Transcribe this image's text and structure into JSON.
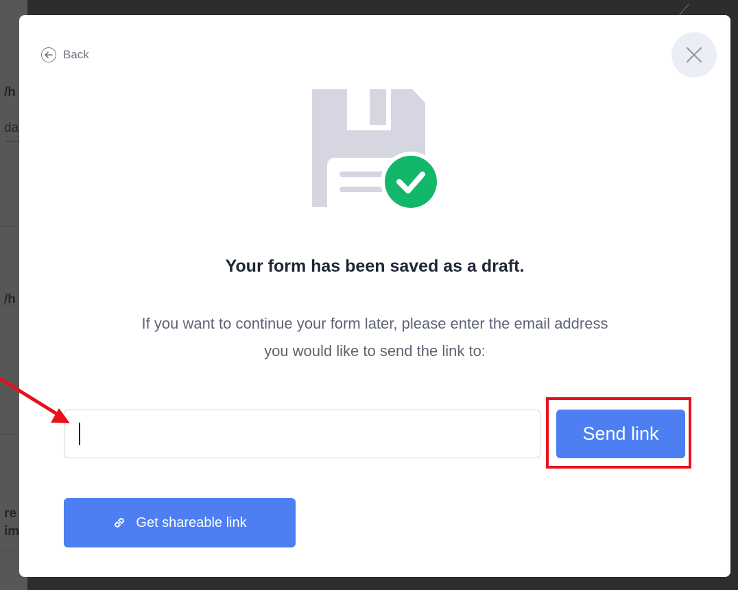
{
  "background": {
    "fragments": [
      "/h",
      "da",
      "/h",
      "re",
      "im"
    ]
  },
  "modal": {
    "back_label": "Back",
    "title": "Your form has been saved as a draft.",
    "subtitle_line1": "If you want to continue your form later, please enter the email address",
    "subtitle_line2": "you would like to send the link to:",
    "email_input": {
      "value": "",
      "placeholder": ""
    },
    "send_button_label": "Send link",
    "share_button_label": "Get shareable link"
  },
  "icons": {
    "back": "arrow-left-circle-icon",
    "close": "close-icon",
    "illustration": "floppy-disk-check-icon",
    "share": "link-icon"
  },
  "colors": {
    "primary": "#4d7ff2",
    "success": "#12b76a",
    "annotation": "#e8111b"
  }
}
